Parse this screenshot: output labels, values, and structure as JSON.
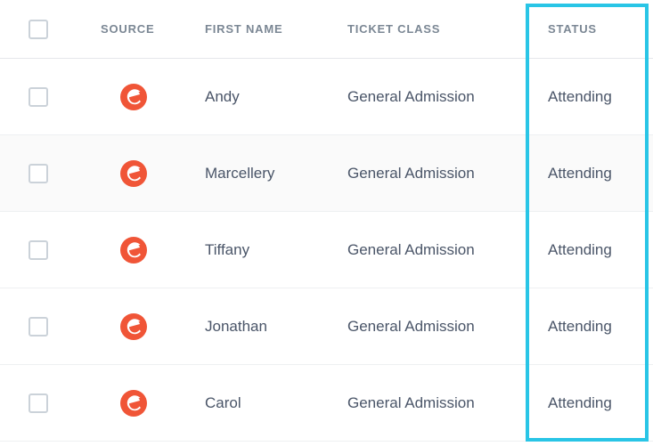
{
  "headers": {
    "source": "SOURCE",
    "first_name": "FIRST NAME",
    "ticket_class": "TICKET CLASS",
    "status": "STATUS"
  },
  "rows": [
    {
      "first_name": "Andy",
      "ticket_class": "General Admission",
      "status": "Attending",
      "source": "eventbrite"
    },
    {
      "first_name": "Marcellery",
      "ticket_class": "General Admission",
      "status": "Attending",
      "source": "eventbrite"
    },
    {
      "first_name": "Tiffany",
      "ticket_class": "General Admission",
      "status": "Attending",
      "source": "eventbrite"
    },
    {
      "first_name": "Jonathan",
      "ticket_class": "General Admission",
      "status": "Attending",
      "source": "eventbrite"
    },
    {
      "first_name": "Carol",
      "ticket_class": "General Admission",
      "status": "Attending",
      "source": "eventbrite"
    }
  ]
}
